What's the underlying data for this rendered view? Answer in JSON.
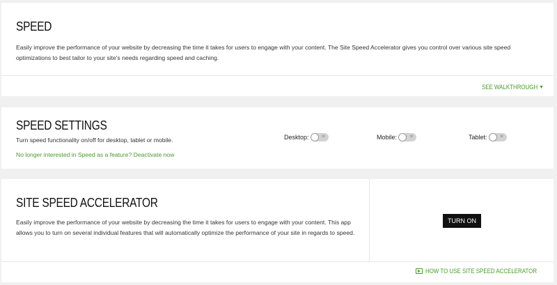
{
  "speed": {
    "title": "SPEED",
    "description": "Easily improve the performance of your website by decreasing the time it takes for users to engage with your content. The Site Speed Accelerator gives you control over various site speed optimizations to best tailor to your site's needs regarding speed and caching.",
    "walkthrough_link": "SEE WALKTHROUGH"
  },
  "speed_settings": {
    "title": "SPEED SETTINGS",
    "description": "Turn speed functionality on/off for desktop, tablet or mobile.",
    "deactivate_link": "No longer interested in Speed as a feature? Deactivate now",
    "toggles": [
      {
        "label": "Desktop:",
        "state": "off"
      },
      {
        "label": "Mobile:",
        "state": "off"
      },
      {
        "label": "Tablet:",
        "state": "off"
      }
    ]
  },
  "accelerator": {
    "title": "SITE SPEED ACCELERATOR",
    "description": "Easily improve the performance of your website by decreasing the time it takes for users to engage with your content. This app allows you to turn on several individual features that will automatically optimize the performance of your site in regards to speed.",
    "turn_on_label": "TURN ON",
    "howto_link": "HOW TO USE SITE SPEED ACCELERATOR"
  },
  "colors": {
    "accent_green": "#4a9a2a",
    "button_dark": "#111111",
    "background": "#f0f0f0"
  }
}
